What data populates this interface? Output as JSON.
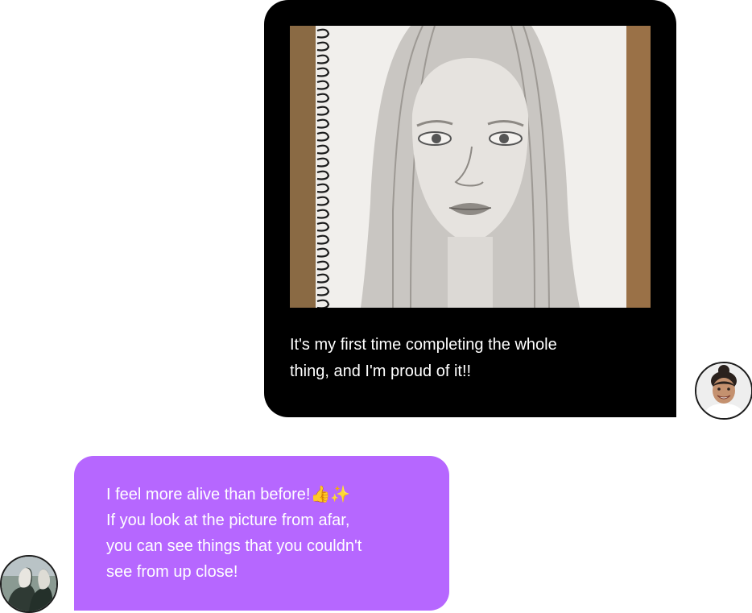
{
  "outgoing_message": {
    "image_icon": "pencil-portrait-sketch",
    "line1": "It's my first time completing the whole",
    "line2": "thing, and I'm proud of it!!"
  },
  "incoming_message": {
    "line1": "I feel more alive than before!👍✨",
    "line2": "If you look at the picture from afar,",
    "line3": "you can see things that you couldn't",
    "line4": "see from up close!"
  },
  "colors": {
    "outgoing_bubble": "#000000",
    "incoming_bubble": "#b667ff",
    "text": "#ffffff"
  }
}
